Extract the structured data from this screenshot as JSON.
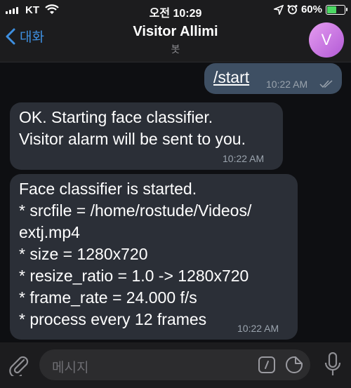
{
  "status_bar": {
    "carrier": "KT",
    "time": "오전 10:29",
    "battery_percent": "60%",
    "battery_level": 0.6
  },
  "header": {
    "back_label": "대화",
    "title": "Visitor Allimi",
    "subtitle": "봇",
    "avatar_initial": "V"
  },
  "messages": [
    {
      "direction": "outgoing",
      "text": "/start",
      "time": "10:22 AM",
      "read": true
    },
    {
      "direction": "incoming",
      "text": "OK. Starting face classifier.\nVisitor alarm will be sent to you.",
      "time": "10:22 AM"
    },
    {
      "direction": "incoming",
      "text": "Face classifier is started.\n* srcfile = /home/rostude/Videos/\nextj.mp4\n* size = 1280x720\n* resize_ratio = 1.0 -> 1280x720\n* frame_rate = 24.000 f/s\n* process every 12 frames",
      "time": "10:22 AM"
    }
  ],
  "composer": {
    "placeholder": "메시지"
  },
  "colors": {
    "accent": "#3e8fe0",
    "incoming_bubble": "#2b2f37",
    "outgoing_bubble": "#3e4f63",
    "avatar": "#c877e3",
    "battery": "#4cd964"
  },
  "icons": [
    "signal-icon",
    "wifi-icon",
    "location-icon",
    "alarm-icon",
    "battery-icon",
    "back-chevron-icon",
    "attach-icon",
    "command-icon",
    "sticker-icon",
    "mic-icon",
    "read-checks-icon"
  ]
}
